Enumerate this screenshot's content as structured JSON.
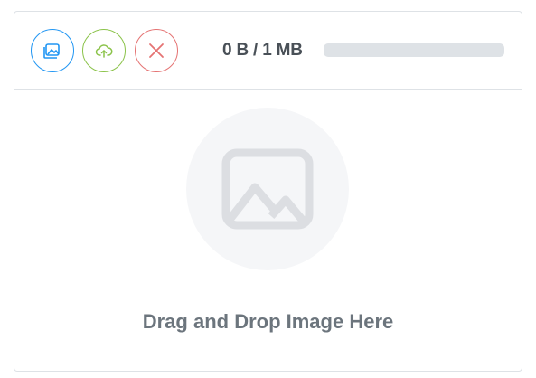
{
  "uploader": {
    "size_label": "0 B / 1 MB",
    "progress": 0,
    "drop_text": "Drag and Drop Image Here"
  },
  "toolbar": {
    "buttons": [
      {
        "icon": "image-icon",
        "color": "#2196f3"
      },
      {
        "icon": "upload-cloud-icon",
        "color": "#8bc34a"
      },
      {
        "icon": "close-icon",
        "color": "#e57373"
      }
    ]
  },
  "placeholder": {
    "icon": "image-placeholder-icon",
    "color": "#dcdee2",
    "background": "#f5f6f8"
  }
}
